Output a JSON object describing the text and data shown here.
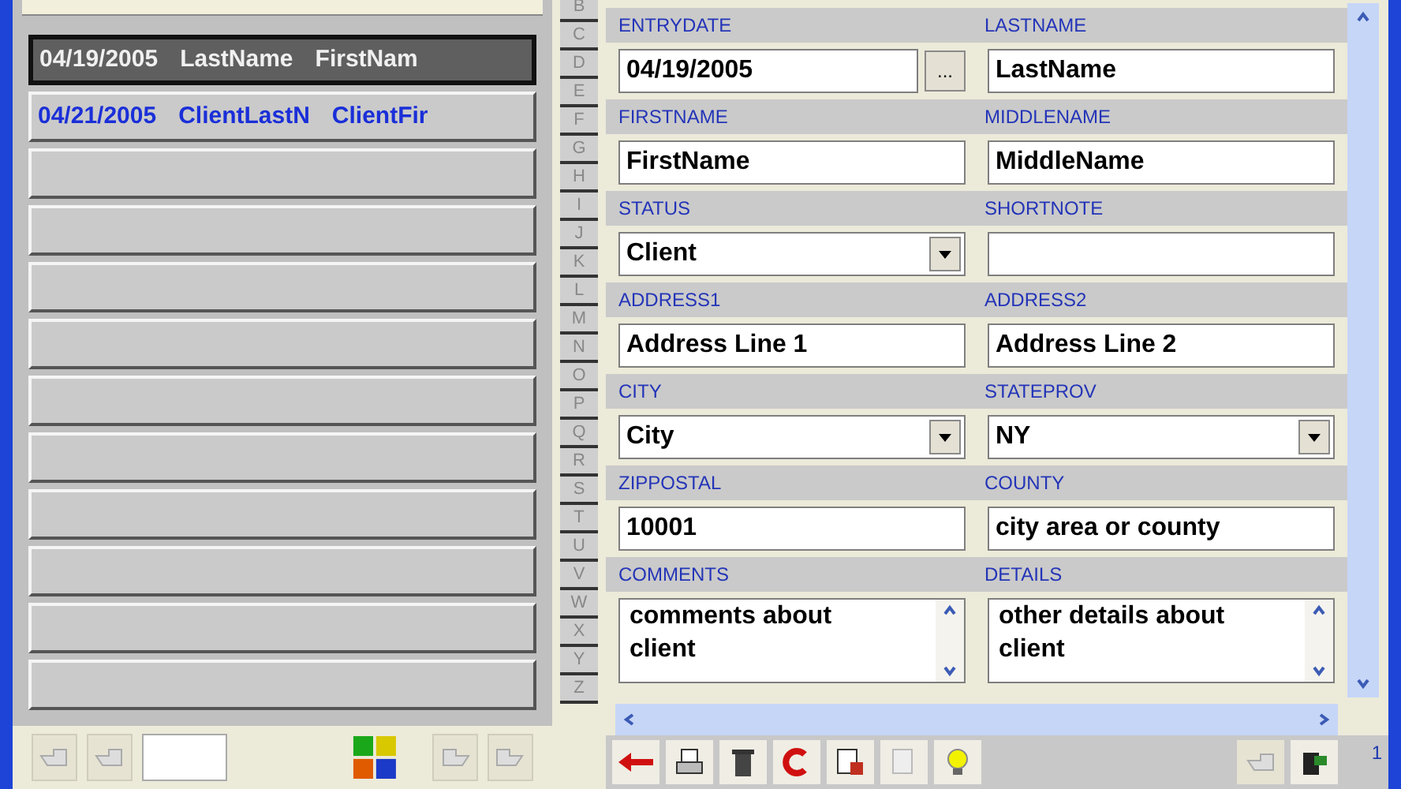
{
  "list": {
    "rows": [
      {
        "date": "04/19/2005",
        "last": "LastName",
        "first": "FirstNam",
        "selected": true
      },
      {
        "date": "04/21/2005",
        "last": "ClientLastN",
        "first": "ClientFir",
        "selected": false
      },
      {
        "selected": false
      },
      {
        "selected": false
      },
      {
        "selected": false
      },
      {
        "selected": false
      },
      {
        "selected": false
      },
      {
        "selected": false
      },
      {
        "selected": false
      },
      {
        "selected": false
      },
      {
        "selected": false
      },
      {
        "selected": false
      }
    ]
  },
  "alphabet": [
    "B",
    "C",
    "D",
    "E",
    "F",
    "G",
    "H",
    "I",
    "J",
    "K",
    "L",
    "M",
    "N",
    "O",
    "P",
    "Q",
    "R",
    "S",
    "T",
    "U",
    "V",
    "W",
    "X",
    "Y",
    "Z"
  ],
  "form": {
    "rows": [
      [
        {
          "label": "ENTRYDATE",
          "value": "04/19/2005",
          "kind": "date",
          "button": "..."
        },
        {
          "label": "LASTNAME",
          "value": "LastName",
          "kind": "text"
        }
      ],
      [
        {
          "label": "FIRSTNAME",
          "value": "FirstName",
          "kind": "text"
        },
        {
          "label": "MIDDLENAME",
          "value": "MiddleName",
          "kind": "text"
        }
      ],
      [
        {
          "label": "STATUS",
          "value": "Client",
          "kind": "dropdown"
        },
        {
          "label": "SHORTNOTE",
          "kind": "text"
        }
      ],
      [
        {
          "label": "ADDRESS1",
          "value": "Address Line 1",
          "kind": "text"
        },
        {
          "label": "ADDRESS2",
          "value": "Address Line 2",
          "kind": "text"
        }
      ],
      [
        {
          "label": "CITY",
          "value": "City",
          "kind": "dropdown"
        },
        {
          "label": "STATEPROV",
          "value": "NY",
          "kind": "dropdown"
        }
      ],
      [
        {
          "label": "ZIPPOSTAL",
          "value": "10001",
          "kind": "text"
        },
        {
          "label": "COUNTY",
          "value": "city area or county",
          "kind": "text"
        }
      ],
      [
        {
          "label": "COMMENTS",
          "value": "comments about client",
          "kind": "memo"
        },
        {
          "label": "DETAILS",
          "value": "other details about client",
          "kind": "memo"
        }
      ]
    ]
  },
  "page_indicator": "1"
}
